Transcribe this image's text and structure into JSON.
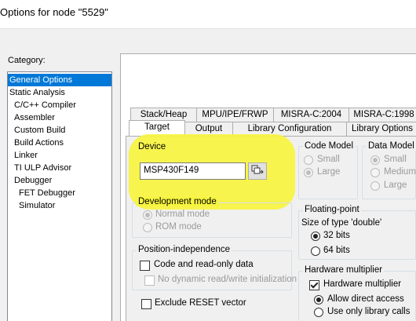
{
  "window": {
    "title": "Options for node \"5529\""
  },
  "category": {
    "label": "Category:",
    "items": [
      {
        "label": "General Options",
        "selected": true,
        "indent": 0
      },
      {
        "label": "Static Analysis",
        "indent": 0
      },
      {
        "label": "C/C++ Compiler",
        "indent": 1
      },
      {
        "label": "Assembler",
        "indent": 1
      },
      {
        "label": "Custom Build",
        "indent": 1
      },
      {
        "label": "Build Actions",
        "indent": 1
      },
      {
        "label": "Linker",
        "indent": 1
      },
      {
        "label": "TI ULP Advisor",
        "indent": 1
      },
      {
        "label": "Debugger",
        "indent": 1
      },
      {
        "label": "FET Debugger",
        "indent": 2
      },
      {
        "label": "Simulator",
        "indent": 2
      }
    ]
  },
  "tabs": {
    "row_back": [
      "Stack/Heap",
      "MPU/IPE/FRWP",
      "MISRA-C:2004",
      "MISRA-C:1998"
    ],
    "row_front": [
      "Target",
      "Output",
      "Library Configuration",
      "Library Options"
    ],
    "active": "Target"
  },
  "device": {
    "group_label": "Device",
    "value": "MSP430F149"
  },
  "code_model": {
    "label": "Code Model",
    "options": [
      "Small",
      "Large"
    ],
    "selected": "Large"
  },
  "data_model": {
    "label": "Data Model",
    "options": [
      "Small",
      "Medium",
      "Large"
    ],
    "selected": "Small"
  },
  "dev_mode": {
    "label": "Development mode",
    "options": [
      "Normal mode",
      "ROM mode"
    ],
    "selected": "Normal mode"
  },
  "floating_point": {
    "label": "Floating-point",
    "size_label": "Size of type 'double'",
    "options": [
      "32 bits",
      "64 bits"
    ],
    "selected": "32 bits"
  },
  "position_independence": {
    "label": "Position-independence",
    "code_ro": "Code and read-only data",
    "no_dynamic": "No dynamic read/write initialization"
  },
  "hardware_multiplier": {
    "label": "Hardware multiplier",
    "checkbox": "Hardware multiplier",
    "options": [
      "Allow direct access",
      "Use only library calls"
    ],
    "selected": "Allow direct access"
  },
  "exclude_reset": "Exclude RESET vector",
  "colors": {
    "highlight": "#f7f43f",
    "selection": "#0078d7"
  },
  "icons": {
    "device_browse": "device-browse-icon"
  }
}
